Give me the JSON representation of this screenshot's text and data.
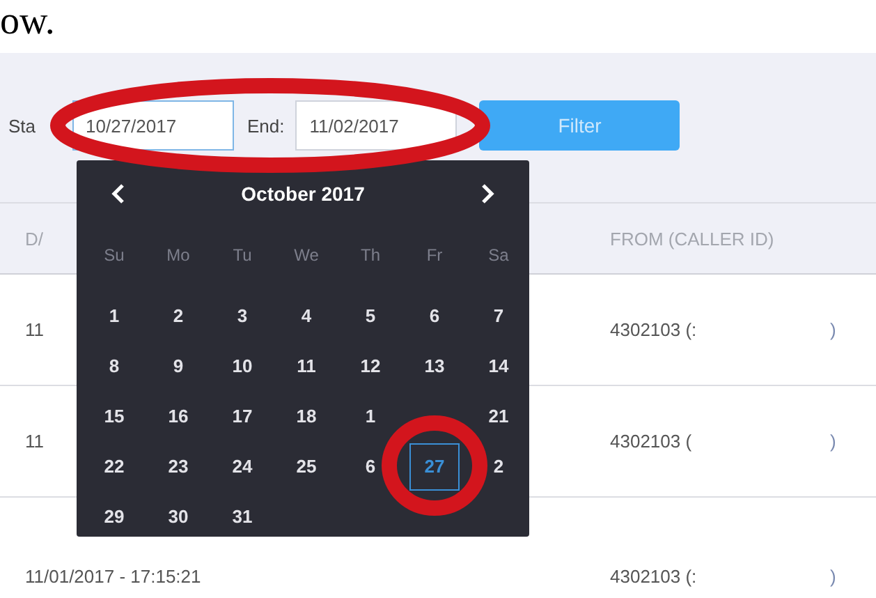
{
  "intro_text": "ow.",
  "filter": {
    "start_label": "Sta",
    "start_value": "10/27/2017",
    "end_label": "End:",
    "end_value": "11/02/2017",
    "button": "Filter"
  },
  "calendar": {
    "title": "October 2017",
    "weekdays": [
      "Su",
      "Mo",
      "Tu",
      "We",
      "Th",
      "Fr",
      "Sa"
    ],
    "weeks": [
      [
        {
          "day": "1",
          "selected": false
        },
        {
          "day": "2",
          "selected": false
        },
        {
          "day": "3",
          "selected": false
        },
        {
          "day": "4",
          "selected": false
        },
        {
          "day": "5",
          "selected": false
        },
        {
          "day": "6",
          "selected": false
        },
        {
          "day": "7",
          "selected": false
        }
      ],
      [
        {
          "day": "8",
          "selected": false
        },
        {
          "day": "9",
          "selected": false
        },
        {
          "day": "10",
          "selected": false
        },
        {
          "day": "11",
          "selected": false
        },
        {
          "day": "12",
          "selected": false
        },
        {
          "day": "13",
          "selected": false
        },
        {
          "day": "14",
          "selected": false
        }
      ],
      [
        {
          "day": "15",
          "selected": false
        },
        {
          "day": "16",
          "selected": false
        },
        {
          "day": "17",
          "selected": false
        },
        {
          "day": "18",
          "selected": false
        },
        {
          "day": "1",
          "selected": false
        },
        {
          "selected": false
        },
        {
          "day": "21",
          "selected": false
        }
      ],
      [
        {
          "day": "22",
          "selected": false
        },
        {
          "day": "23",
          "selected": false
        },
        {
          "day": "24",
          "selected": false
        },
        {
          "day": "25",
          "selected": false
        },
        {
          "day": "6",
          "selected": false
        },
        {
          "day": "27",
          "selected": true
        },
        {
          "day": "2",
          "selected": false
        }
      ],
      [
        {
          "day": "29",
          "selected": false
        },
        {
          "day": "30",
          "selected": false
        },
        {
          "day": "31",
          "selected": false
        }
      ]
    ]
  },
  "table": {
    "columns": [
      "D/",
      "FROM (CALLER ID)"
    ],
    "rows": [
      {
        "date": "11",
        "from": "4302103 (:",
        "tail": ")"
      },
      {
        "date": "11",
        "from": "4302103 (",
        "tail": ")"
      },
      {
        "date": "11/01/2017 - 17:15:21",
        "from": "4302103 (:",
        "tail": ")"
      }
    ]
  },
  "annotations": [
    {
      "kind": "ellipse"
    },
    {
      "kind": "ellipse"
    }
  ]
}
